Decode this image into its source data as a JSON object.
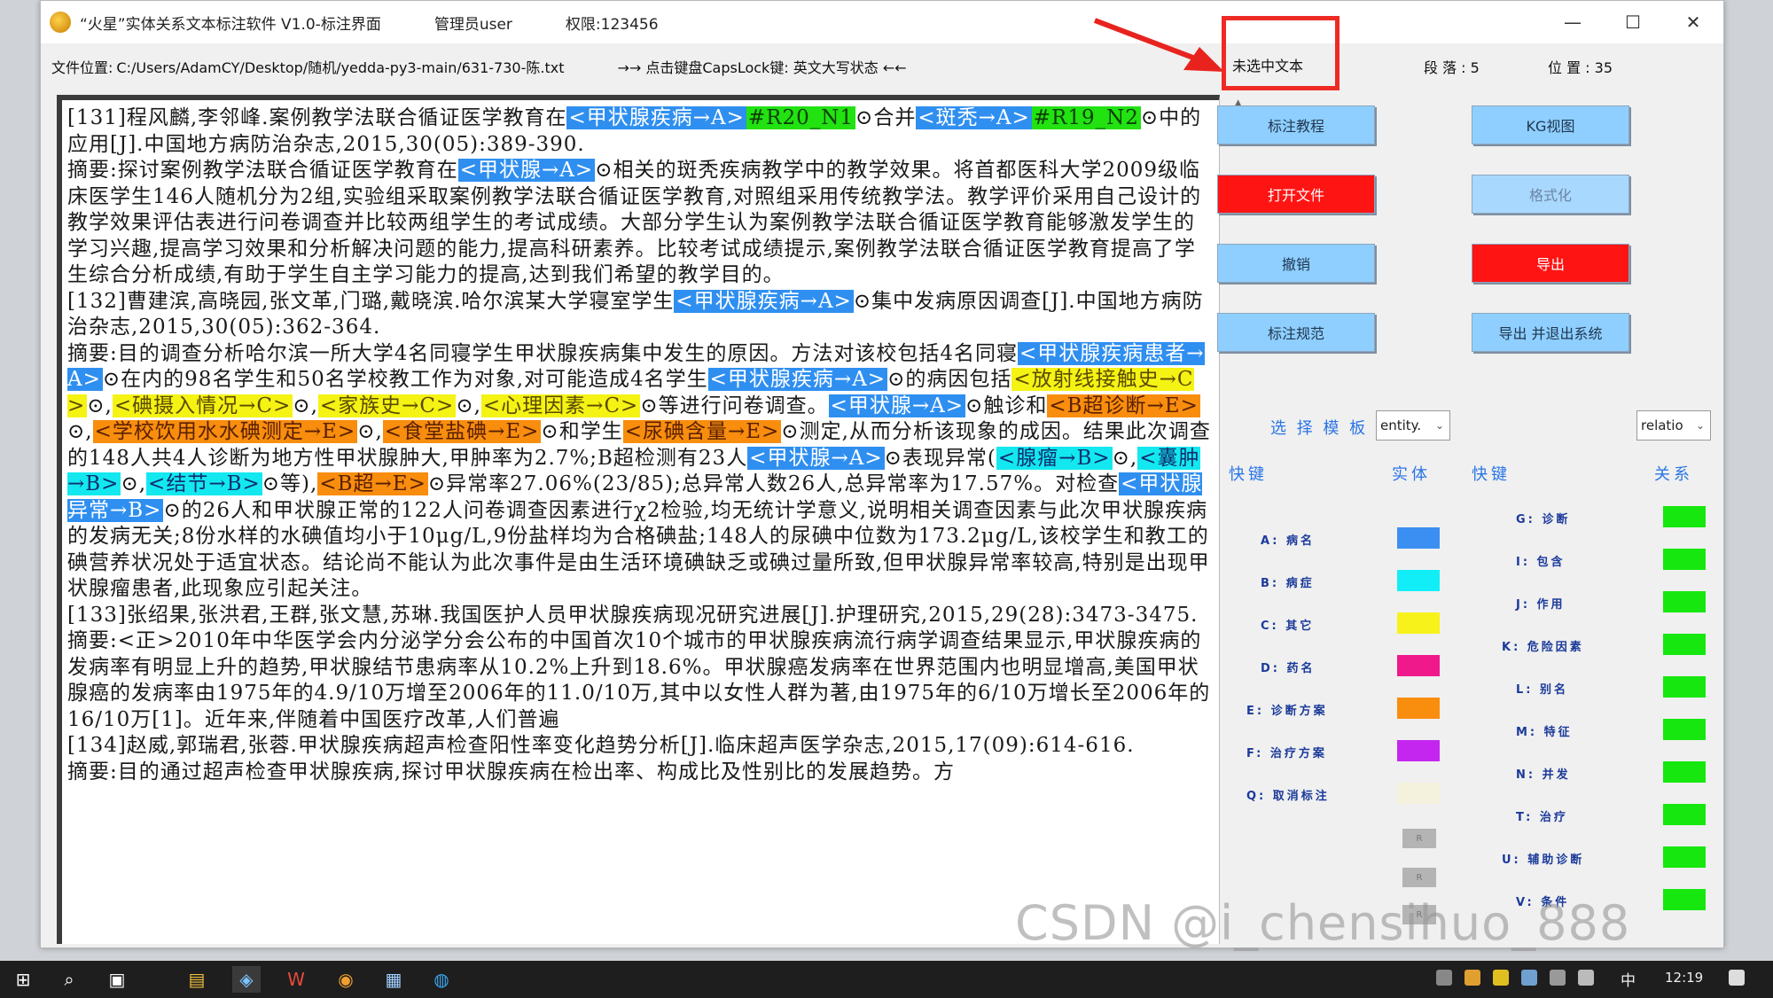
{
  "window": {
    "title": "“火星”实体关系文本标注软件 V1.0-标注界面",
    "admin_label": "管理员user",
    "permission_label": "权限:123456",
    "minimize_glyph": "—",
    "maximize_glyph": "☐",
    "close_glyph": "✕"
  },
  "infobar": {
    "file_label": "文件位置:",
    "file_path": "C:/Users/AdamCY/Desktop/随机/yedda-py3-main/631-730-陈.txt",
    "capslock_hint": "→→ 点击键盘CapsLock键: 英文大写状态 ←←"
  },
  "right_panel": {
    "selected_text_label": "未选中文本",
    "paragraph_info": "段 落 : 5",
    "position_info": "位 置 : 35",
    "buttons": {
      "tutorial": "标注教程",
      "kg_chart": "KG视图",
      "open_file": "打开文件",
      "format": "格式化",
      "undo": "撤销",
      "export": "导出",
      "spec": "标注规范",
      "export_exit": "导出 并退出系统"
    },
    "template_label": "选 择 模 板 :",
    "entity_select": "entity.",
    "relation_select": "relatio",
    "shortcut_header_1": "快键",
    "entity_header": "实体",
    "shortcut_header_2": "快键",
    "relation_header": "关系",
    "entities": [
      {
        "label": "A: 病名",
        "color": "#3b8ff2"
      },
      {
        "label": "B: 病症",
        "color": "#12eef7"
      },
      {
        "label": "C: 其它",
        "color": "#f7f21a"
      },
      {
        "label": "D: 药名",
        "color": "#f0198c"
      },
      {
        "label": "E: 诊断方案",
        "color": "#f88d0e"
      },
      {
        "label": "F: 治疗方案",
        "color": "#c426f0"
      },
      {
        "label": "Q: 取消标注",
        "color": "#f4f2dc"
      }
    ],
    "grey_chips": [
      "R",
      "R",
      "R"
    ],
    "relations": [
      {
        "label": "G: 诊断"
      },
      {
        "label": "I: 包含"
      },
      {
        "label": "J: 作用"
      },
      {
        "label": "K: 危险因素"
      },
      {
        "label": "L: 别名"
      },
      {
        "label": "M: 特征"
      },
      {
        "label": "N: 并发"
      },
      {
        "label": "T: 治疗"
      },
      {
        "label": "U: 辅助诊断"
      },
      {
        "label": "V: 条件"
      }
    ],
    "relation_color": "#16e80f"
  },
  "text": {
    "p1_a": "[131]程风麟,李邻峰.案例教学法联合循证医学教育在",
    "p1_tag1": "<甲状腺疾病→A>",
    "p1_tag2": "#R20_N1",
    "p1_b": "合并",
    "p1_tag3": "<斑秃→A>",
    "p1_tag4": "#R19_N2",
    "p1_c": "中的应用[J].中国地方病防治杂志,2015,30(05):389-390.",
    "p2_a": "摘要:探讨案例教学法联合循证医学教育在",
    "p2_tag1": "<甲状腺→A>",
    "p2_b": "相关的斑秃疾病教学中的教学效果。将首都医科大学2009级临床医学生146人随机分为2组,实验组采取案例教学法联合循证医学教育,对照组采用传统教学法。教学评价采用自己设计的教学效果评估表进行问卷调查并比较两组学生的考试成绩。大部分学生认为案例教学法联合循证医学教育能够激发学生的学习兴趣,提高学习效果和分析解决问题的能力,提高科研素养。比较考试成绩提示,案例教学法联合循证医学教育提高了学生综合分析成绩,有助于学生自主学习能力的提高,达到我们希望的教学目的。",
    "p3_a": "[132]曹建滨,高晓园,张文革,门璐,戴晓滨.哈尔滨某大学寝室学生",
    "p3_tag1": "<甲状腺疾病→A>",
    "p3_b": "集中发病原因调查[J].中国地方病防治杂志,2015,30(05):362-364.",
    "p4_a": "摘要:目的调查分析哈尔滨一所大学4名同寝学生甲状腺疾病集中发生的原因。方法对该校包括4名同寝",
    "p4_tag1": "<甲状腺疾病患者→A>",
    "p4_b": "在内的98名学生和50名学校教工作为对象,对可能造成4名学生",
    "p4_tag2": "<甲状腺疾病→A>",
    "p4_c": "的病因包括",
    "p4_tag3": "<放射线接触史→C>",
    "p4_tag4": "<碘摄入情况→C>",
    "p4_tag5": "<家族史→C>",
    "p4_tag6": "<心理因素→C>",
    "p4_d": "等进行问卷调查。",
    "p4_tag7": "<甲状腺→A>",
    "p4_e": "触诊和",
    "p4_tag8": "<B超诊断→E>",
    "p4_tag9": "<学校饮用水水碘测定→E>",
    "p4_tag10": "<食堂盐碘→E>",
    "p4_f": "和学生",
    "p4_tag11": "<尿碘含量→E>",
    "p4_g": "测定,从而分析该现象的成因。结果此次调查的148人共4人诊断为地方性甲状腺肿大,甲肿率为2.7%;B超检测有23人",
    "p4_tag12": "<甲状腺→A>",
    "p4_h": "表现异常(",
    "p4_tag13": "<腺瘤→B>",
    "p4_tag14": "<囊肿→B>",
    "p4_tag15": "<结节→B>",
    "p4_i": "等),",
    "p4_tag16": "<B超→E>",
    "p4_j": "异常率27.06%(23/85);总异常人数26人,总异常率为17.57%。对检查",
    "p4_tag17": "<甲状腺异常→B>",
    "p4_k": "的26人和甲状腺正常的122人问卷调查因素进行χ2检验,均无统计学意义,说明相关调查因素与此次甲状腺疾病的发病无关;8份水样的水碘值均小于10μg/L,9份盐样均为合格碘盐;148人的尿碘中位数为173.2μg/L,该校学生和教工的碘营养状况处于适宜状态。结论尚不能认为此次事件是由生活环境碘缺乏或碘过量所致,但甲状腺异常率较高,特别是出现甲状腺瘤患者,此现象应引起关注。",
    "p5_a": "[133]张绍果,张洪君,王群,张文慧,苏琳.我国医护人员甲状腺疾病现况研究进展[J].护理研究,2015,29(28):3473-3475.",
    "p6_a": "摘要:<正>2010年中华医学会内分泌学分会公布的中国首次10个城市的甲状腺疾病流行病学调查结果显示,甲状腺疾病的发病率有明显上升的趋势,甲状腺结节患病率从10.2%上升到18.6%。甲状腺癌发病率在世界范围内也明显增高,美国甲状腺癌的发病率由1975年的4.9/10万增至2006年的11.0/10万,其中以女性人群为著,由1975年的6/10万增长至2006年的16/10万[1]。近年来,伴随着中国医疗改革,人们普遍",
    "p7_a": "[134]赵威,郭瑞君,张蓉.甲状腺疾病超声检查阳性率变化趋势分析[J].临床超声医学杂志,2015,17(09):614-616.",
    "p8_a": "摘要:目的通过超声检查甲状腺疾病,探讨甲状腺疾病在检出率、构成比及性别比的发展趋势。方",
    "circle": "⊙",
    "circle_cm": "⊙,"
  },
  "watermark": "CSDN @i_chensihuo_888",
  "taskbar": {
    "lang": "中",
    "time": "12:19"
  }
}
